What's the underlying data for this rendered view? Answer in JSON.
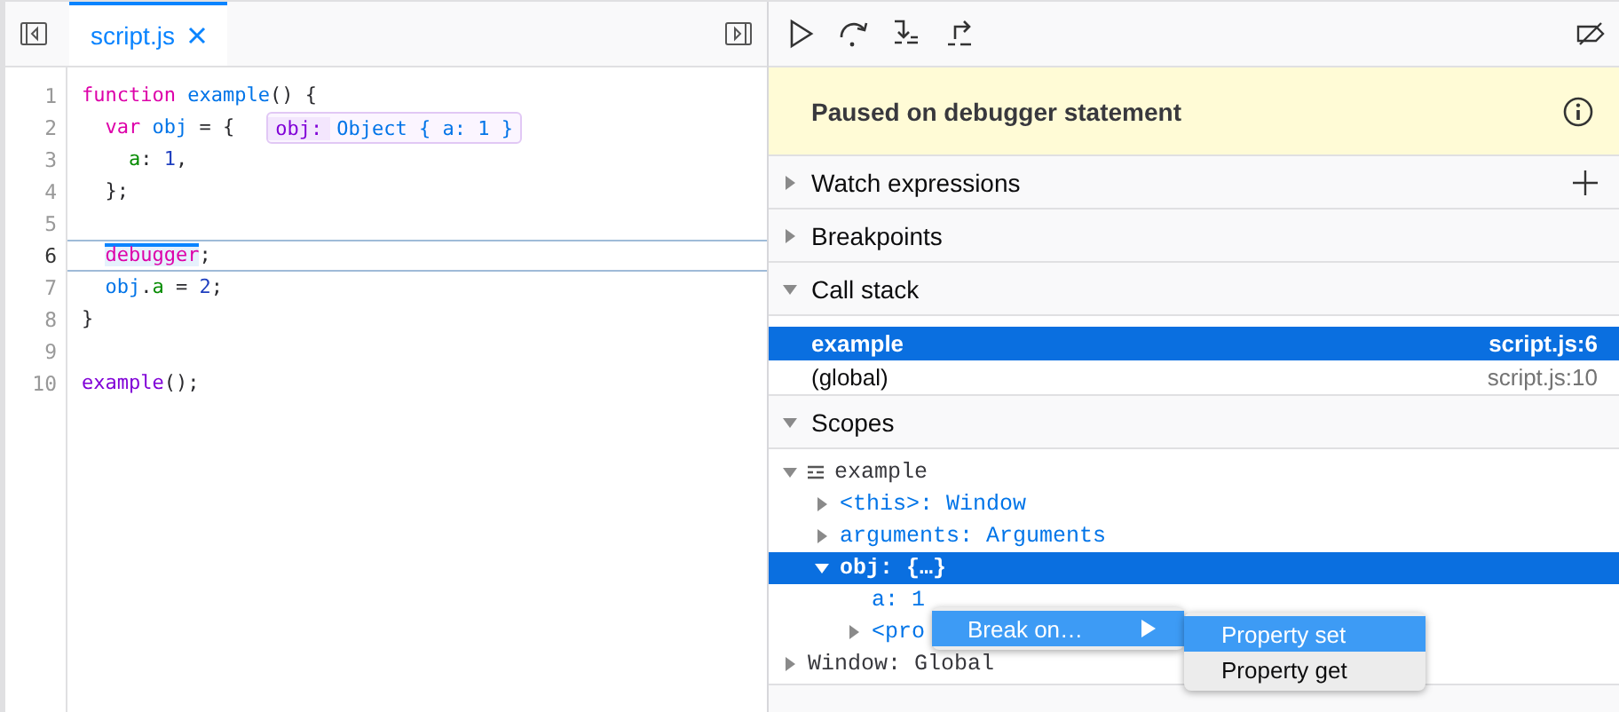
{
  "editor": {
    "tabs": [
      {
        "label": "script.js",
        "selected": true
      }
    ],
    "lines": [
      {
        "number": "1",
        "paused": false,
        "tokens": [
          {
            "t": "function ",
            "kind": "kw"
          },
          {
            "t": "example",
            "kind": "name"
          },
          {
            "t": "() {",
            "kind": "punct"
          }
        ]
      },
      {
        "number": "2",
        "paused": false,
        "tokens": [
          {
            "t": "  var ",
            "kind": "kw"
          },
          {
            "t": "obj",
            "kind": "name"
          },
          {
            "t": " = {",
            "kind": "punct"
          }
        ],
        "preview": {
          "label": "obj:",
          "value": "Object { a: 1 }"
        }
      },
      {
        "number": "3",
        "paused": false,
        "tokens": [
          {
            "t": "    a",
            "kind": "prop"
          },
          {
            "t": ": ",
            "kind": "punct"
          },
          {
            "t": "1",
            "kind": "num"
          },
          {
            "t": ",",
            "kind": "punct"
          }
        ]
      },
      {
        "number": "4",
        "paused": false,
        "tokens": [
          {
            "t": "  };",
            "kind": "punct"
          }
        ]
      },
      {
        "number": "5",
        "paused": false
      },
      {
        "number": "6",
        "paused": true,
        "tokens": [
          {
            "t": "  debugger",
            "kind": "kw"
          },
          {
            "t": ";",
            "kind": "punct"
          }
        ]
      },
      {
        "number": "7",
        "paused": false,
        "tokens": [
          {
            "t": "  obj",
            "kind": "name"
          },
          {
            "t": ".",
            "kind": "punct"
          },
          {
            "t": "a",
            "kind": "prop"
          },
          {
            "t": " = ",
            "kind": "punct"
          },
          {
            "t": "2",
            "kind": "num"
          },
          {
            "t": ";",
            "kind": "punct"
          }
        ]
      },
      {
        "number": "8",
        "paused": false,
        "tokens": [
          {
            "t": "}",
            "kind": "punct"
          }
        ]
      },
      {
        "number": "9",
        "paused": false
      },
      {
        "number": "10",
        "paused": false,
        "tokens": [
          {
            "t": "example",
            "kind": "call"
          },
          {
            "t": "();",
            "kind": "punct"
          }
        ]
      }
    ]
  },
  "pause_banner": {
    "message": "Paused on debugger statement"
  },
  "sections": [
    {
      "title": "Watch expressions",
      "expanded": false,
      "kind": "watch"
    },
    {
      "title": "Breakpoints",
      "expanded": false,
      "kind": "plain"
    },
    {
      "title": "Call stack",
      "expanded": true,
      "kind": "frames",
      "frames": [
        {
          "name": "example",
          "location": "script.js:6",
          "selected": true
        },
        {
          "name": "(global)",
          "location": "script.js:10",
          "selected": false
        }
      ]
    },
    {
      "title": "Scopes",
      "expanded": true,
      "kind": "scopes",
      "tree": [
        {
          "label": "example",
          "kind": "scope",
          "expanded": true,
          "selected": false,
          "children": [
            {
              "label": "<this>: Window",
              "kind": "var",
              "expanded": false,
              "selected": false
            },
            {
              "label": "arguments: Arguments",
              "kind": "var",
              "expanded": false,
              "selected": false
            },
            {
              "label": "obj: {…}",
              "kind": "var",
              "expanded": true,
              "selected": true,
              "children": [
                {
                  "label": "a: 1",
                  "kind": "leaf",
                  "selected": false
                },
                {
                  "label": "<pro",
                  "kind": "var",
                  "expanded": false,
                  "selected": false
                }
              ]
            }
          ]
        },
        {
          "label": "Window: Global",
          "kind": "global",
          "expanded": false,
          "selected": false
        }
      ]
    }
  ],
  "context_menu": {
    "items": [
      {
        "label": "Break on…",
        "selected": true,
        "submenu": [
          {
            "label": "Property set",
            "selected": true
          },
          {
            "label": "Property get",
            "selected": false
          }
        ]
      }
    ]
  }
}
